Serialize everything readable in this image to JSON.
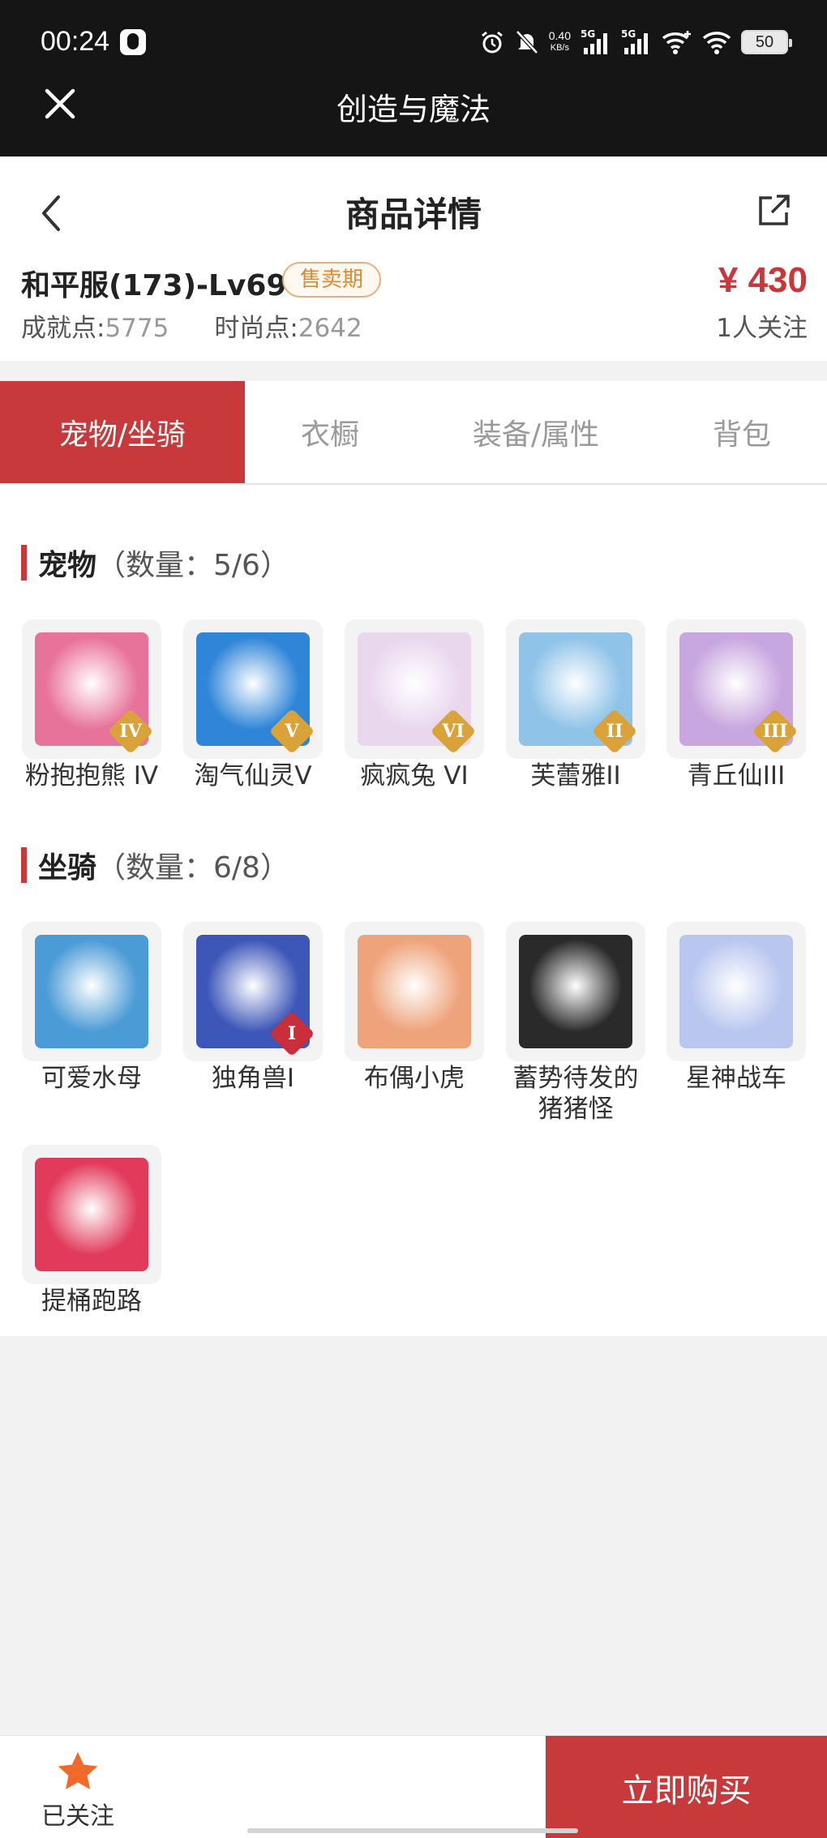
{
  "status_bar": {
    "time": "00:24",
    "net_speed_value": "0.40",
    "net_speed_unit": "KB/s",
    "signal_1": "5G",
    "signal_2": "5G",
    "battery": "50"
  },
  "app_bar": {
    "title": "创造与魔法"
  },
  "header": {
    "title": "商品详情"
  },
  "product": {
    "name": "和平服(173)-Lv69",
    "badge": "售卖期",
    "price": "¥ 430",
    "achievement_label": "成就点:",
    "achievement_value": "5775",
    "fashion_label": "时尚点:",
    "fashion_value": "2642",
    "followers": "1人关注"
  },
  "tabs": [
    {
      "label": "宠物/坐骑",
      "active": true
    },
    {
      "label": "衣橱",
      "active": false
    },
    {
      "label": "装备/属性",
      "active": false
    },
    {
      "label": "背包",
      "active": false
    }
  ],
  "pets_section": {
    "title": "宠物",
    "count": "（数量：5/6）"
  },
  "pets": [
    {
      "label": "粉抱抱熊 IV",
      "badge": "IV",
      "icon": "pink-bear-pet",
      "color": "#e8739a"
    },
    {
      "label": "淘气仙灵V",
      "badge": "V",
      "icon": "blue-dog-pet",
      "color": "#2f86d8"
    },
    {
      "label": "疯疯兔 VI",
      "badge": "VI",
      "icon": "white-rabbit-pet",
      "color": "#e9d7ee"
    },
    {
      "label": "芙蕾雅II",
      "badge": "II",
      "icon": "valkyrie-pet",
      "color": "#8fc3e8"
    },
    {
      "label": "青丘仙III",
      "badge": "III",
      "icon": "fox-fairy-pet",
      "color": "#c8a6df"
    }
  ],
  "mounts_section": {
    "title": "坐骑",
    "count": "（数量：6/8）"
  },
  "mounts": [
    {
      "label": "可爱水母",
      "badge": "",
      "icon": "jellyfish-mount",
      "color": "#4a9bd6"
    },
    {
      "label": "独角兽I",
      "badge": "I",
      "icon": "unicorn-mount",
      "color": "#3d57b8"
    },
    {
      "label": "布偶小虎",
      "badge": "",
      "icon": "tiger-doll-mount",
      "color": "#eea37a"
    },
    {
      "label": "蓄势待发的\n猪猪怪",
      "badge": "",
      "icon": "black-pig-mount",
      "color": "#2a2a2a"
    },
    {
      "label": "星神战车",
      "badge": "",
      "icon": "star-horse-mount",
      "color": "#b9c6ef"
    },
    {
      "label": "提桶跑路",
      "badge": "",
      "icon": "bucket-mount",
      "color": "#e23a5b"
    }
  ],
  "bottom_bar": {
    "follow_label": "已关注",
    "buy_label": "立即购买"
  },
  "colors": {
    "accent": "#c7393a",
    "badge_gold": "#d9a33a",
    "star": "#f26a2a"
  }
}
